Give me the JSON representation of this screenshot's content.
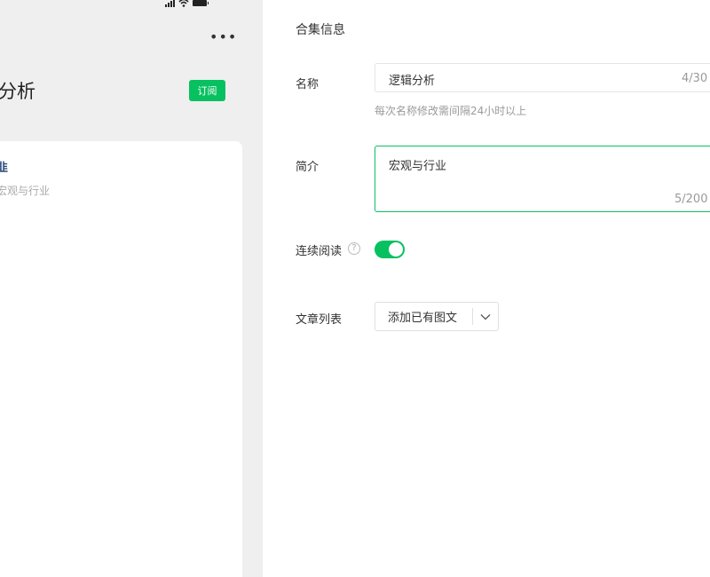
{
  "preview": {
    "title": "分析",
    "subscribe_label": "订阅",
    "more_icon": "more-icon",
    "card": {
      "line1": "韭",
      "line2": "宏观与行业"
    }
  },
  "form": {
    "section_title": "合集信息",
    "name": {
      "label": "名称",
      "value": "逻辑分析",
      "count": "4/30",
      "hint": "每次名称修改需间隔24小时以上"
    },
    "intro": {
      "label": "简介",
      "value": "宏观与行业",
      "count": "5/200"
    },
    "continuous_reading": {
      "label": "连续阅读",
      "help_glyph": "?",
      "enabled": true
    },
    "article_list": {
      "label": "文章列表",
      "button_label": "添加已有图文"
    }
  },
  "colors": {
    "accent": "#07c160",
    "preview_bg": "#efefef",
    "hint": "#9a9a9a"
  }
}
